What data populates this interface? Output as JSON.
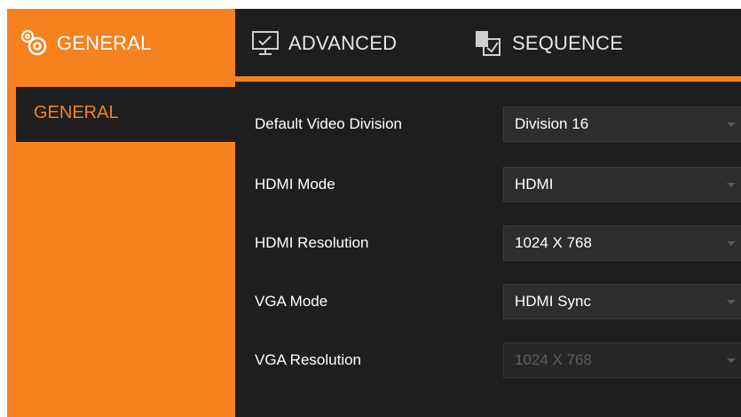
{
  "tabs": [
    {
      "label": "GENERAL",
      "icon": "gears-icon",
      "active": true
    },
    {
      "label": "ADVANCED",
      "icon": "monitor-icon",
      "active": false
    },
    {
      "label": "SEQUENCE",
      "icon": "sequence-icon",
      "active": false
    }
  ],
  "sidebar": {
    "items": [
      {
        "label": "GENERAL",
        "selected": true
      }
    ]
  },
  "settings": [
    {
      "label": "Default Video Division",
      "value": "Division 16",
      "enabled": true
    },
    {
      "label": "HDMI Mode",
      "value": "HDMI",
      "enabled": true
    },
    {
      "label": "HDMI Resolution",
      "value": "1024 X 768",
      "enabled": true
    },
    {
      "label": "VGA Mode",
      "value": "HDMI Sync",
      "enabled": true
    },
    {
      "label": "VGA Resolution",
      "value": "1024 X 768",
      "enabled": false
    }
  ],
  "colors": {
    "accent": "#f5821f",
    "panel": "#1e1e1e",
    "field": "#2d2d2d"
  }
}
